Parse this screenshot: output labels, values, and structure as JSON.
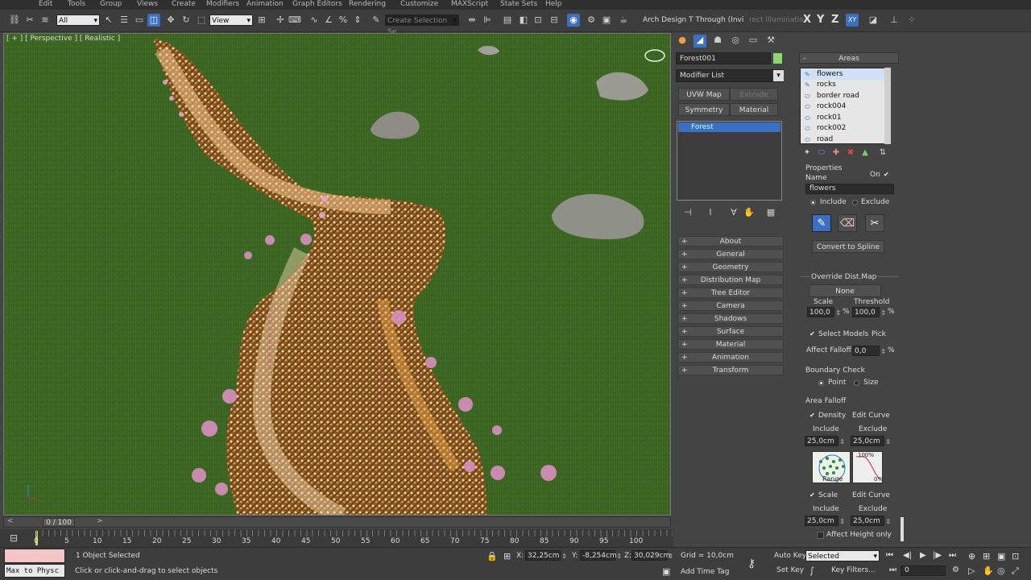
{
  "menu": [
    "Edit",
    "Tools",
    "Group",
    "Views",
    "Create",
    "Modifiers",
    "Animation",
    "Graph Editors",
    "Rendering",
    "Customize",
    "MAXScript",
    "State Sets",
    "Help"
  ],
  "toolbar": {
    "selection_filter": "All",
    "ref_coord": "View",
    "named_selection_placeholder": "Create Selection Se",
    "workspace_label": "Arch  Design T Through (Invi",
    "workspace_extra": "rect Illuminatio",
    "axis_x": "X",
    "axis_y": "Y",
    "axis_z": "Z",
    "axis_xy": "XY"
  },
  "viewport": {
    "label": "[ + ] [ Perspective ] [ Realistic ]"
  },
  "command_panel": {
    "object_name": "Forest001",
    "modifier_list": "Modifier List",
    "buttons": [
      "UVW Map",
      "Extrude",
      "Symmetry",
      "Material"
    ],
    "stack_item": "Forest",
    "rollouts": [
      "About",
      "General",
      "Geometry",
      "Distribution Map",
      "Tree Editor",
      "Camera",
      "Shadows",
      "Surface",
      "Material",
      "Animation",
      "Transform"
    ]
  },
  "areas": {
    "title": "Areas",
    "items": [
      "flowers",
      "rocks",
      "border road",
      "rock004",
      "rock01",
      "rock002",
      "road"
    ],
    "properties_label": "Properties",
    "name_label": "Name",
    "on_label": "On",
    "name_value": "flowers",
    "include_label": "Include",
    "exclude_label": "Exclude",
    "convert_to_spline": "Convert to Spline",
    "override_dist_map": "Override Dist.Map",
    "none_button": "None",
    "scale_label": "Scale",
    "threshold_label": "Threshold",
    "scale_value": "100,0",
    "threshold_value": "100,0",
    "pct": "%",
    "select_models": "Select Models",
    "pick": "Pick",
    "affect_falloff": "Affect Falloff",
    "affect_falloff_value": "0,0",
    "boundary_check": "Boundary Check",
    "point": "Point",
    "size": "Size",
    "area_falloff": "Area Falloff",
    "density": "Density",
    "edit_curve": "Edit Curve",
    "include_val": "25,0cm",
    "exclude_val": "25,0cm",
    "range_label": "Range",
    "pct_100": "100%",
    "pct_0": "0%",
    "scale": "Scale",
    "edit_curve2": "Edit Curve",
    "include_val2": "25,0cm",
    "exclude_val2": "25,0cm",
    "affect_height_only": "Affect Height only"
  },
  "timeline": {
    "frame_display": "0 / 100",
    "ticks": [
      "0",
      "5",
      "10",
      "15",
      "20",
      "25",
      "30",
      "35",
      "40",
      "45",
      "50",
      "55",
      "60",
      "65",
      "70",
      "75",
      "80",
      "85",
      "90",
      "95",
      "100"
    ]
  },
  "status": {
    "maxscript_label": "Max to Physc",
    "selection_count": "1 Object Selected",
    "prompt": "Click or click-and-drag to select objects",
    "x_label": "X:",
    "x_value": "32,25cm",
    "y_label": "Y:",
    "y_value": "-8,254cm",
    "z_label": "Z:",
    "z_value": "30,029cm",
    "grid": "Grid = 10,0cm",
    "add_time_tag": "Add Time Tag",
    "auto_key": "Auto Key",
    "key_mode": "Selected",
    "set_key": "Set Key",
    "key_filters": "Key Filters...",
    "current_frame": "0"
  },
  "colors": {
    "accent": "#3a6fc2",
    "grass": "#3f6a25",
    "path": "#c98a3a"
  }
}
